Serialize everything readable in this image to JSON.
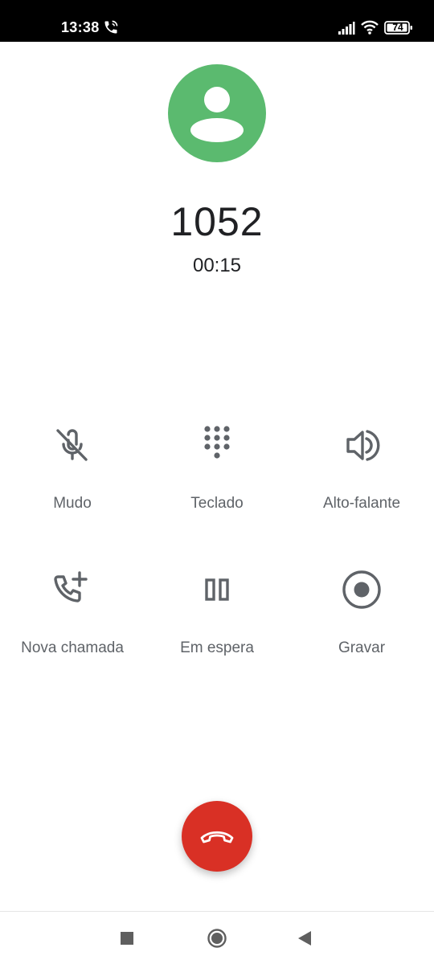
{
  "status_bar": {
    "time": "13:38",
    "battery": "74",
    "icons": [
      "call-in-progress-icon",
      "signal-icon",
      "wifi-icon",
      "battery-icon"
    ]
  },
  "caller": {
    "number": "1052",
    "duration": "00:15",
    "avatar_color": "#5bba6f"
  },
  "controls": [
    {
      "label": "Mudo",
      "icon": "mic-off-icon"
    },
    {
      "label": "Teclado",
      "icon": "dialpad-icon"
    },
    {
      "label": "Alto-falante",
      "icon": "speaker-icon"
    },
    {
      "label": "Nova chamada",
      "icon": "add-call-icon"
    },
    {
      "label": "Em espera",
      "icon": "pause-icon"
    },
    {
      "label": "Gravar",
      "icon": "record-icon"
    }
  ],
  "end_call": {
    "icon": "call-end-icon",
    "color": "#d93025"
  },
  "nav_bar": {
    "buttons": [
      "recents-square-icon",
      "home-circle-icon",
      "back-triangle-icon"
    ]
  },
  "colors": {
    "icon_gray": "#5f6368",
    "text_dark": "#202124"
  }
}
